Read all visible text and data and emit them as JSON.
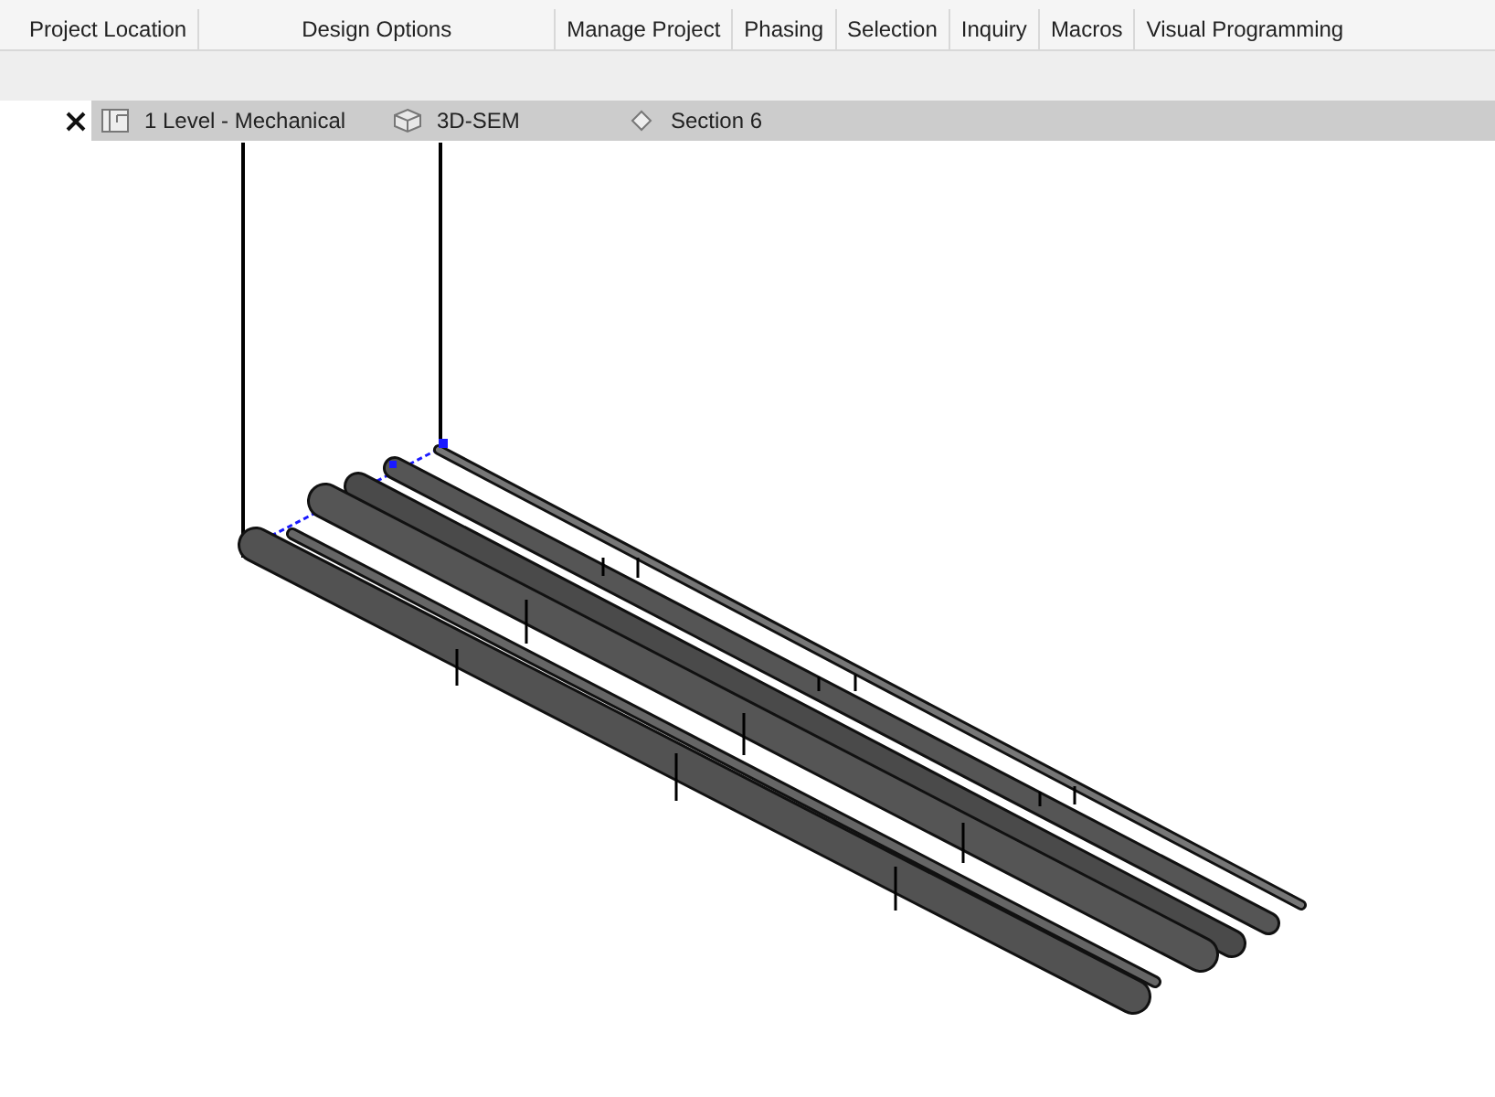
{
  "ribbon_panels": [
    {
      "label": "Project Location"
    },
    {
      "label": "Design Options"
    },
    {
      "label": "Manage Project"
    },
    {
      "label": "Phasing"
    },
    {
      "label": "Selection"
    },
    {
      "label": "Inquiry"
    },
    {
      "label": "Macros"
    },
    {
      "label": "Visual Programming"
    }
  ],
  "view_tabs": [
    {
      "label": "1 Level - Mechanical",
      "kind": "plan",
      "selected": false
    },
    {
      "label": "3D-SEM",
      "kind": "model",
      "selected": false
    },
    {
      "label": "Section 6",
      "kind": "section",
      "selected": false
    }
  ]
}
